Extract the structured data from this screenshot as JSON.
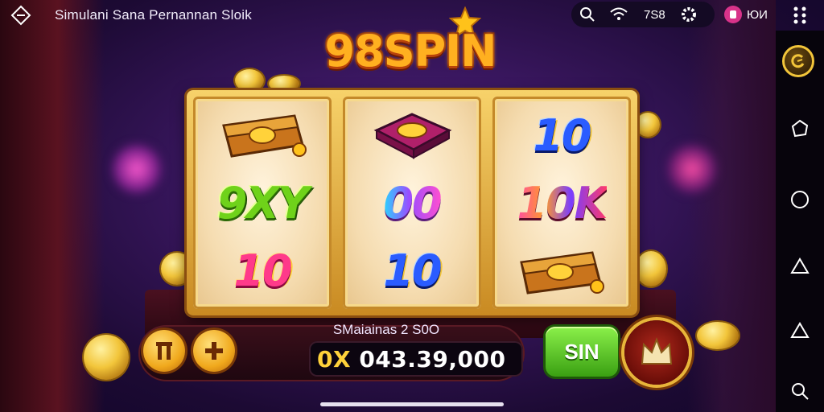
{
  "window": {
    "title": "Simulani Sana Pernannan Sloik"
  },
  "status": {
    "signal_text": "7S8",
    "user_label": "ЮИ"
  },
  "logo": {
    "text": "98SPIN"
  },
  "reels": [
    {
      "symbols": [
        {
          "kind": "chest",
          "text": ""
        },
        {
          "kind": "text",
          "text": "9XY",
          "style": "t-green"
        },
        {
          "kind": "text",
          "text": "10",
          "style": "t-pink"
        }
      ]
    },
    {
      "symbols": [
        {
          "kind": "box",
          "text": ""
        },
        {
          "kind": "text",
          "text": "00",
          "style": "t-rainbow"
        },
        {
          "kind": "text",
          "text": "10",
          "style": "t-blue"
        }
      ]
    },
    {
      "symbols": [
        {
          "kind": "text",
          "text": "10",
          "style": "t-blue"
        },
        {
          "kind": "text",
          "text": "10K",
          "style": "t-multi"
        },
        {
          "kind": "chest",
          "text": ""
        }
      ]
    }
  ],
  "controls": {
    "balance_label": "SMaiainas 2 S0O",
    "balance_prefix": "0X",
    "balance_value": "043.39,000",
    "spin_label": "SIN"
  },
  "colors": {
    "accent_gold": "#f2c53a",
    "spin_green": "#3aa012",
    "bg_purple": "#3a1760"
  },
  "icons": [
    "back-icon",
    "search-icon",
    "wifi-icon",
    "settings-icon",
    "user-icon",
    "menu-icon",
    "coin-icon",
    "hexagon-icon",
    "circle-icon",
    "home-icon",
    "search-icon"
  ]
}
